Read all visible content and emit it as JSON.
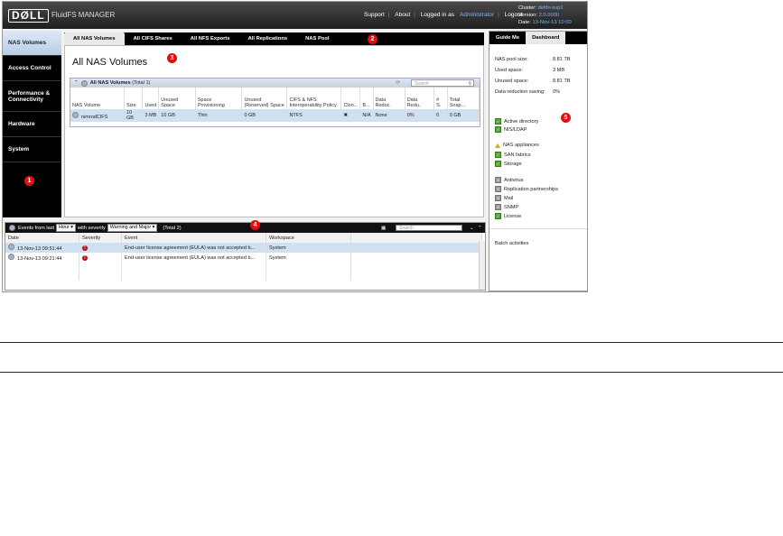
{
  "topbar": {
    "logo": "DØLL",
    "app_name": "FluidFS MANAGER",
    "support": "Support",
    "about": "About",
    "logged_in_as": "Logged in as",
    "username": "Administrator",
    "logout": "Logout",
    "cluster_label": "Cluster:",
    "cluster_value": "dellfs-sup1",
    "version_label": "Version:",
    "version_value": "2.0.0000",
    "date_label": "Date:",
    "date_value": "13-Nov-13 10:00"
  },
  "leftnav": {
    "items": [
      {
        "label": "NAS Volumes"
      },
      {
        "label": "Access Control"
      },
      {
        "label": "Performance & Connectivity"
      },
      {
        "label": "Hardware"
      },
      {
        "label": "System"
      }
    ]
  },
  "tabs": [
    "All NAS Volumes",
    "All CIFS Shares",
    "All NFS Exports",
    "All Replications",
    "NAS Pool"
  ],
  "main": {
    "title": "All NAS Volumes",
    "grid_title": "All NAS Volumes",
    "grid_total": "(Total 1)",
    "search_placeholder": "Search",
    "columns": [
      "NAS Volume",
      "Size",
      "Used",
      "Unused Space",
      "Space Provisioning",
      "Unused (Reserved) Space",
      "CIFS & NFS Interoperability Policy",
      "Clon...",
      "B...",
      "Data Reduc.",
      "Data Redu.",
      "# S.",
      "Total Snap..."
    ],
    "rows": [
      [
        "nimrodCIFS",
        "10 GB",
        "3 MB",
        "10 GB",
        "Thin",
        "0 GB",
        "NTFS",
        "✖",
        "N/A",
        "None",
        "0%",
        "0",
        "0 GB"
      ]
    ]
  },
  "right": {
    "tabs": [
      "Guide Me",
      "Dashboard"
    ],
    "stats": [
      {
        "label": "NAS pool size:",
        "value": "8.81 TB"
      },
      {
        "label": "Used space:",
        "value": "3 MB"
      },
      {
        "label": "Unused space:",
        "value": "8.81 TB"
      },
      {
        "label": "Data reduction saving:",
        "value": "0%"
      }
    ],
    "status_groups": [
      [
        {
          "label": "Active directory",
          "state": "ok"
        },
        {
          "label": "NIS/LDAP",
          "state": "ok"
        }
      ],
      [
        {
          "label": "NAS appliances",
          "state": "warn"
        },
        {
          "label": "SAN fabrics",
          "state": "ok"
        },
        {
          "label": "Storage",
          "state": "ok"
        }
      ],
      [
        {
          "label": "Antivirus",
          "state": "na"
        },
        {
          "label": "Replication partnerships",
          "state": "na"
        },
        {
          "label": "Mail",
          "state": "na"
        },
        {
          "label": "SNMP",
          "state": "na"
        },
        {
          "label": "License",
          "state": "ok"
        }
      ]
    ],
    "batch_activities": "Batch activities"
  },
  "events": {
    "prefix": "Events from last",
    "period": "Hour",
    "with_severity": "with severity",
    "severity": "Warning and Major",
    "total": "(Total 2)",
    "search_placeholder": "Search",
    "columns": [
      "Date",
      "Severity",
      "Event",
      "Workspace"
    ],
    "rows": [
      {
        "date": "13-Nov-13 09:51:44",
        "event": "End-user license agreement (EULA) was not accepted b...",
        "workspace": "System"
      },
      {
        "date": "13-Nov-13 09:21:44",
        "event": "End-user license agreement (EULA) was not accepted b...",
        "workspace": "System"
      }
    ]
  },
  "callouts": [
    "1",
    "2",
    "3",
    "4",
    "5"
  ],
  "colors": {
    "callout": "#e01010",
    "selected_row": "#cfe0f2",
    "nav_bg": "#000000"
  }
}
